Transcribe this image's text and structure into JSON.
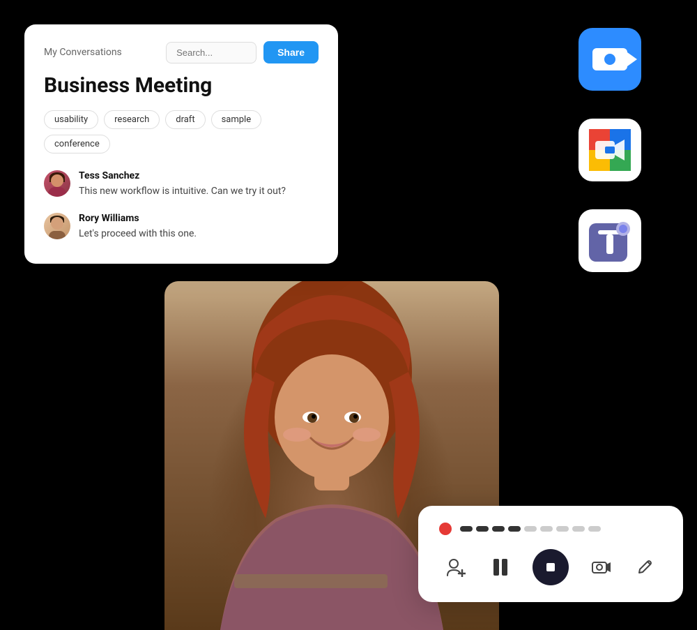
{
  "conversations_card": {
    "label": "My Conversations",
    "search_placeholder": "Search...",
    "share_button": "Share",
    "meeting_title": "Business Meeting",
    "tags": [
      "usability",
      "research",
      "draft",
      "sample",
      "conference"
    ],
    "messages": [
      {
        "sender": "Tess Sanchez",
        "text": "This new workflow is intuitive. Can we try it out?",
        "avatar_type": "tess"
      },
      {
        "sender": "Rory Williams",
        "text": "Let's proceed with this one.",
        "avatar_type": "rory"
      }
    ]
  },
  "app_icons": [
    {
      "name": "zoom",
      "label": "Zoom"
    },
    {
      "name": "google-meet",
      "label": "Google Meet"
    },
    {
      "name": "microsoft-teams",
      "label": "Microsoft Teams"
    }
  ],
  "recording_controls": {
    "progress_bars": [
      4,
      4,
      0,
      0,
      0,
      0,
      0,
      0
    ],
    "controls": [
      {
        "id": "add-person",
        "label": "Add person"
      },
      {
        "id": "pause",
        "label": "Pause"
      },
      {
        "id": "stop",
        "label": "Stop recording"
      },
      {
        "id": "camera",
        "label": "Camera"
      },
      {
        "id": "edit",
        "label": "Edit"
      }
    ]
  }
}
